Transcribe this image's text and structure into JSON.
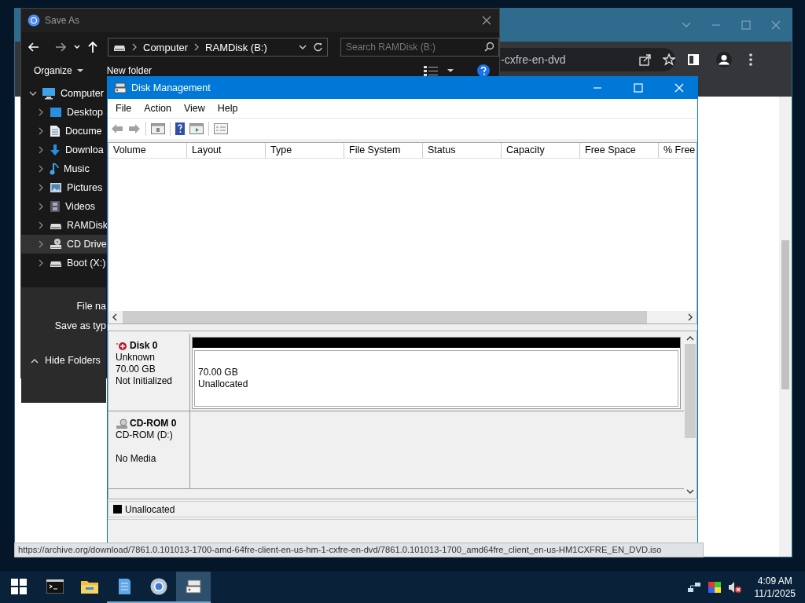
{
  "browser": {
    "omnibox_text": "-cxfre-en-dvd",
    "status_url": "https://archive.org/download/7861.0.101013-1700-amd-64fre-client-en-us-hm-1-cxfre-en-dvd/7861.0.101013-1700_amd64fre_client_en-us-HM1CXFRE_EN_DVD.iso"
  },
  "save_as": {
    "title": "Save As",
    "path": [
      "Computer",
      "RAMDisk (B:)"
    ],
    "search": {
      "placeholder": "Search RAMDisk (B:)"
    },
    "toolbar": [
      "Organize",
      "New folder"
    ],
    "tree": [
      {
        "label": "Computer",
        "kind": "computer",
        "expanded": true,
        "selected": false,
        "children": [
          {
            "label": "Desktop",
            "kind": "desktop",
            "expanded": false,
            "selected": false
          },
          {
            "label": "Docume",
            "kind": "documents",
            "expanded": false,
            "selected": false
          },
          {
            "label": "Downloa",
            "kind": "downloads",
            "expanded": false,
            "selected": false
          },
          {
            "label": "Music",
            "kind": "music",
            "expanded": false,
            "selected": false
          },
          {
            "label": "Pictures",
            "kind": "pictures",
            "expanded": false,
            "selected": false
          },
          {
            "label": "Videos",
            "kind": "videos",
            "expanded": false,
            "selected": false
          },
          {
            "label": "RAMDisk",
            "kind": "drive",
            "expanded": false,
            "selected": false
          },
          {
            "label": "CD Drive",
            "kind": "cd",
            "expanded": false,
            "selected": true
          },
          {
            "label": "Boot (X:)",
            "kind": "drive",
            "expanded": false,
            "selected": false
          }
        ]
      }
    ],
    "fields": [
      "File na",
      "Save as typ"
    ],
    "hide_folders": "Hide Folders"
  },
  "disk_management": {
    "title": "Disk Management",
    "menu": [
      "File",
      "Action",
      "View",
      "Help"
    ],
    "columns": [
      "Volume",
      "Layout",
      "Type",
      "File System",
      "Status",
      "Capacity",
      "Free Space",
      "% Free"
    ],
    "disks": [
      {
        "kind": "disk",
        "name": "Disk 0",
        "type": "Unknown",
        "size": "70.00 GB",
        "status": "Not Initialized",
        "partitions": [
          {
            "size": "70.00 GB",
            "label": "Unallocated",
            "color": "#000000"
          }
        ]
      },
      {
        "kind": "cdrom",
        "name": "CD-ROM 0",
        "type": "CD-ROM (D:)",
        "status": "No Media"
      }
    ],
    "legend": [
      {
        "label": "Unallocated",
        "color": "#000000"
      }
    ]
  },
  "taskbar": {
    "apps": [
      {
        "kind": "terminal",
        "running": false,
        "selected": false
      },
      {
        "kind": "explorer",
        "running": false,
        "selected": false
      },
      {
        "kind": "notepad",
        "running": true,
        "selected": false
      },
      {
        "kind": "chrome",
        "running": true,
        "selected": false
      },
      {
        "kind": "diskmgmt",
        "running": true,
        "selected": true
      }
    ],
    "clock": {
      "time": "4:09 AM",
      "date": "11/1/2025"
    }
  }
}
